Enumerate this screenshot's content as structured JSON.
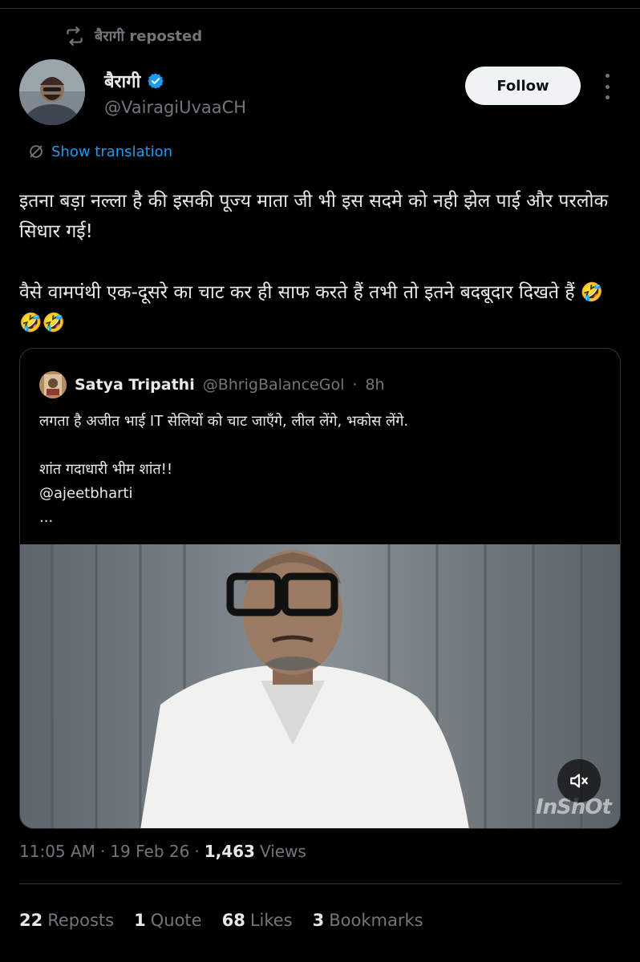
{
  "repost": {
    "label": "बैरागी reposted"
  },
  "author": {
    "name": "बैरागी",
    "handle": "@VairagiUvaaCH",
    "verified": true
  },
  "follow_label": "Follow",
  "translation_label": "Show translation",
  "tweet": {
    "paragraph1": "इतना बड़ा नल्ला है की इसकी पूज्य माता जी भी इस सदमे को नही झेल पाई और परलोक सिधार गई!",
    "paragraph2": "वैसे वामपंथी एक-दूसरे का चाट कर ही साफ करते हैं तभी तो इतने बदबूदार दिखते हैं 🤣🤣🤣"
  },
  "quoted": {
    "name": "Satya Tripathi",
    "handle": "@BhrigBalanceGol",
    "separator": "·",
    "time": "8h",
    "line1": "लगता है अजीत भाई IT सेलियों को चाट जाएँगे, लील लेंगे, भकोस लेंगे.",
    "line2": "शांत गदाधारी भीम शांत!!",
    "mention": "@ajeetbharti",
    "ellipsis": "...",
    "watermark": "InShOt"
  },
  "meta": {
    "time": "11:05 AM",
    "sep1": "·",
    "date": "19 Feb 26",
    "sep2": "·",
    "views_count": "1,463",
    "views_label": "Views"
  },
  "stats": {
    "reposts_count": "22",
    "reposts_label": "Reposts",
    "quotes_count": "1",
    "quotes_label": "Quote",
    "likes_count": "68",
    "likes_label": "Likes",
    "bookmarks_count": "3",
    "bookmarks_label": "Bookmarks"
  },
  "colors": {
    "background": "#000000",
    "text": "#e7e9ea",
    "muted": "#71767b",
    "link": "#1d9bf0",
    "divider": "#2f3336",
    "verified": "#1d9bf0"
  },
  "icons": [
    "repost-icon",
    "verified-badge-icon",
    "more-icon",
    "translate-icon",
    "mute-icon"
  ]
}
